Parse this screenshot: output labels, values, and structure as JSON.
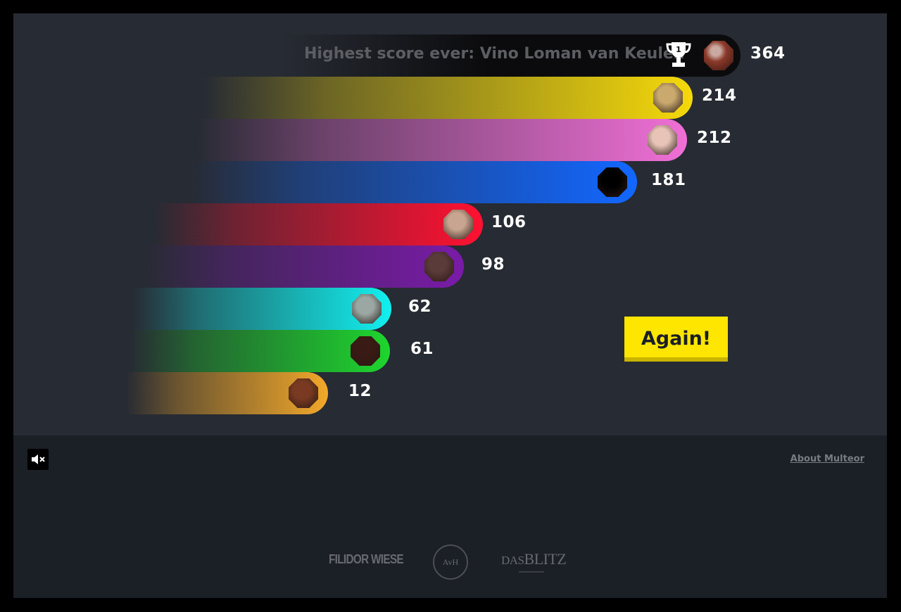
{
  "highscore": {
    "label": "Highest score ever: Vino Loman van Keulen",
    "score": "364",
    "trophy_icon": "trophy-icon",
    "avatar_color": "#8b3a2a"
  },
  "bars": [
    {
      "score": "214",
      "value": 214,
      "color": "#f5d90a",
      "avatar_bg": "#c9a96e"
    },
    {
      "score": "212",
      "value": 212,
      "color": "#f06fd6",
      "avatar_bg": "#e8c4b8"
    },
    {
      "score": "181",
      "value": 181,
      "color": "#1267ff",
      "avatar_bg": "#000000"
    },
    {
      "score": "106",
      "value": 106,
      "color": "#ff1131",
      "avatar_bg": "#c8a590"
    },
    {
      "score": "98",
      "value": 98,
      "color": "#7a1ba8",
      "avatar_bg": "#5b3a3a"
    },
    {
      "score": "62",
      "value": 62,
      "color": "#12f0ef",
      "avatar_bg": "#9aa7a3"
    },
    {
      "score": "61",
      "value": 61,
      "color": "#1ed62e",
      "avatar_bg": "#3a1a14"
    },
    {
      "score": "12",
      "value": 12,
      "color": "#f2a82a",
      "avatar_bg": "#7a3a22"
    }
  ],
  "again_label": "Again!",
  "mute_icon": "speaker-muted-icon",
  "about_label": "About Multeor",
  "footer": {
    "logo1": "FILIDOR WIESE",
    "logo2": "AvH",
    "logo3_a": "DAS",
    "logo3_b": "BLITZ"
  }
}
